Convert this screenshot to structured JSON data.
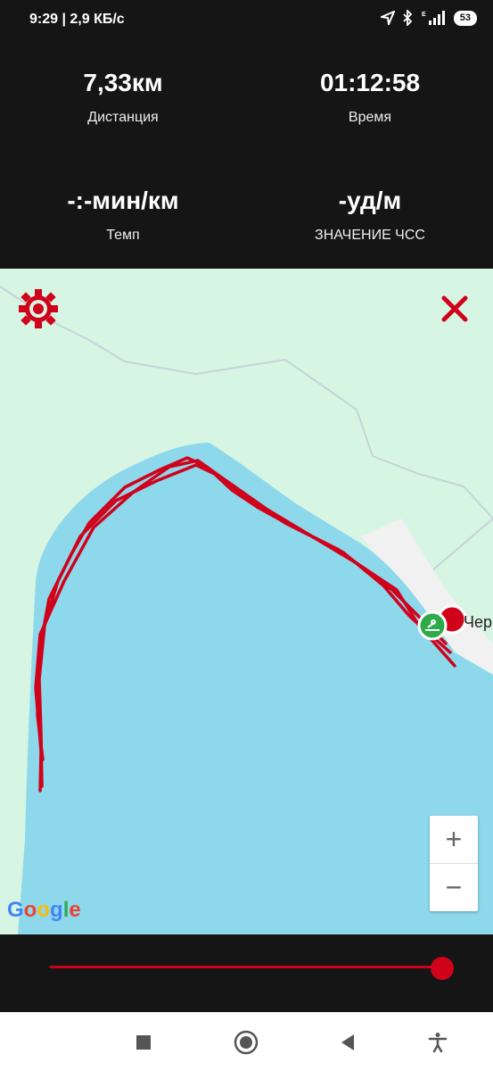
{
  "status_bar": {
    "time": "9:29 | 2,9 КБ/с",
    "battery": "53",
    "icons": [
      "location-arrow-icon",
      "bluetooth-icon",
      "signal-icon",
      "battery-icon"
    ]
  },
  "stats": {
    "distance": {
      "value": "7,33км",
      "label": "Дистанция"
    },
    "time": {
      "value": "01:12:58",
      "label": "Время"
    },
    "pace": {
      "value": "-:-мин/км",
      "label": "Темп"
    },
    "heart_rate": {
      "value": "-уд/м",
      "label": "ЗНАЧЕНИЕ ЧСС"
    }
  },
  "map": {
    "place_label": "Чер",
    "attribution": "Google",
    "zoom_in_label": "+",
    "zoom_out_label": "−",
    "track_color": "#d0021b",
    "water_color": "#8ed8ec",
    "land_color": "#d7f5e3"
  },
  "timeline": {
    "progress": 1.0,
    "accent_color": "#d0021b"
  },
  "nav_bar": {
    "items": [
      "recent-apps-icon",
      "home-icon",
      "back-icon",
      "accessibility-icon"
    ]
  }
}
